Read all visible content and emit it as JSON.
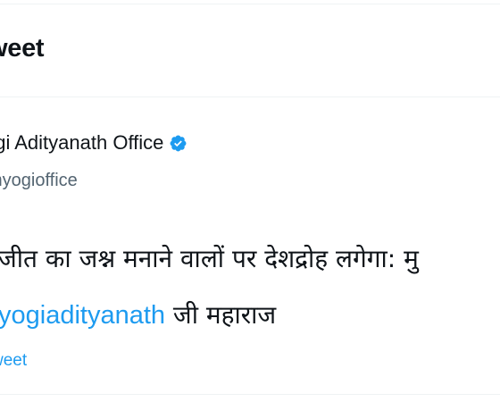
{
  "header": {
    "title": "weet"
  },
  "tweet": {
    "display_name": "ogi Adityanath Office",
    "verified_icon": "verified-badge-icon",
    "handle": "myogioffice",
    "text_line1": "जीत का जश्न मनाने वालों पर देशद्रोह लगेगा: मु",
    "mention": "yogiadityanath",
    "text_line2_rest": " जी महाराज",
    "footer_link": "weet"
  },
  "colors": {
    "accent": "#1d9bf0",
    "text": "#0f1419",
    "muted": "#536471",
    "divider": "#eff3f4"
  }
}
